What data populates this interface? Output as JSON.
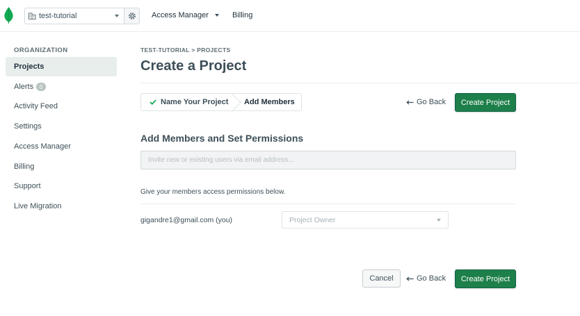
{
  "header": {
    "org_name": "test-tutorial",
    "nav": [
      {
        "label": "Access Manager"
      },
      {
        "label": "Billing"
      }
    ]
  },
  "sidebar": {
    "heading": "ORGANIZATION",
    "items": [
      {
        "label": "Projects"
      },
      {
        "label": "Alerts",
        "badge": "0"
      },
      {
        "label": "Activity Feed"
      },
      {
        "label": "Settings"
      },
      {
        "label": "Access Manager"
      },
      {
        "label": "Billing"
      },
      {
        "label": "Support"
      },
      {
        "label": "Live Migration"
      }
    ]
  },
  "main": {
    "breadcrumb": "TEST-TUTORIAL > PROJECTS",
    "title": "Create a Project",
    "steps": [
      {
        "label": "Name Your Project",
        "completed": true
      },
      {
        "label": "Add Members",
        "current": true
      }
    ],
    "go_back": "Go Back",
    "create_project": "Create Project",
    "cancel": "Cancel",
    "section_title": "Add Members and Set Permissions",
    "invite_placeholder": "Invite new or existing users via email address...",
    "permissions_text": "Give your members access permissions below.",
    "members": [
      {
        "email": "gigandre1@gmail.com (you)",
        "role": "Project Owner"
      }
    ]
  },
  "colors": {
    "brand_green": "#13aa52",
    "primary_button": "#1d7f4a",
    "active_sidebar_bg": "#e7eeec"
  },
  "icons": [
    "mongodb-leaf-logo",
    "building-icon",
    "gear-icon",
    "checkmark-icon",
    "arrow-left-icon",
    "chevron-down-icon"
  ]
}
